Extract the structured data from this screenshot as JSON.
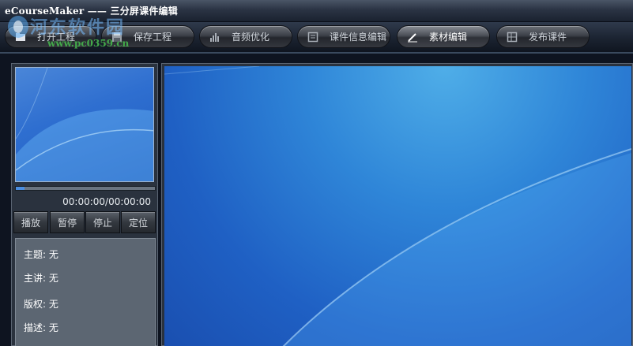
{
  "window": {
    "title": "eCourseMaker —— 三分屏课件编辑"
  },
  "watermark": {
    "line1": "河东软件园",
    "line2": "www.pc0359.cn"
  },
  "toolbar": {
    "buttons": [
      {
        "label": "打开工程",
        "icon": "folder-icon"
      },
      {
        "label": "保存工程",
        "icon": "save-icon"
      },
      {
        "label": "音频优化",
        "icon": "equalizer-icon"
      },
      {
        "label": "课件信息编辑",
        "icon": "edit-doc-icon"
      },
      {
        "label": "素材编辑",
        "icon": "pen-icon",
        "active": true
      },
      {
        "label": "发布课件",
        "icon": "publish-icon"
      }
    ]
  },
  "player": {
    "time": "00:00:00/00:00:00",
    "progress": 0.06,
    "controls": [
      "播放",
      "暂停",
      "停止",
      "定位"
    ]
  },
  "info": {
    "topic": "主题: 无",
    "speaker": "主讲: 无",
    "copyright": "版权: 无",
    "description": "描述: 无"
  }
}
